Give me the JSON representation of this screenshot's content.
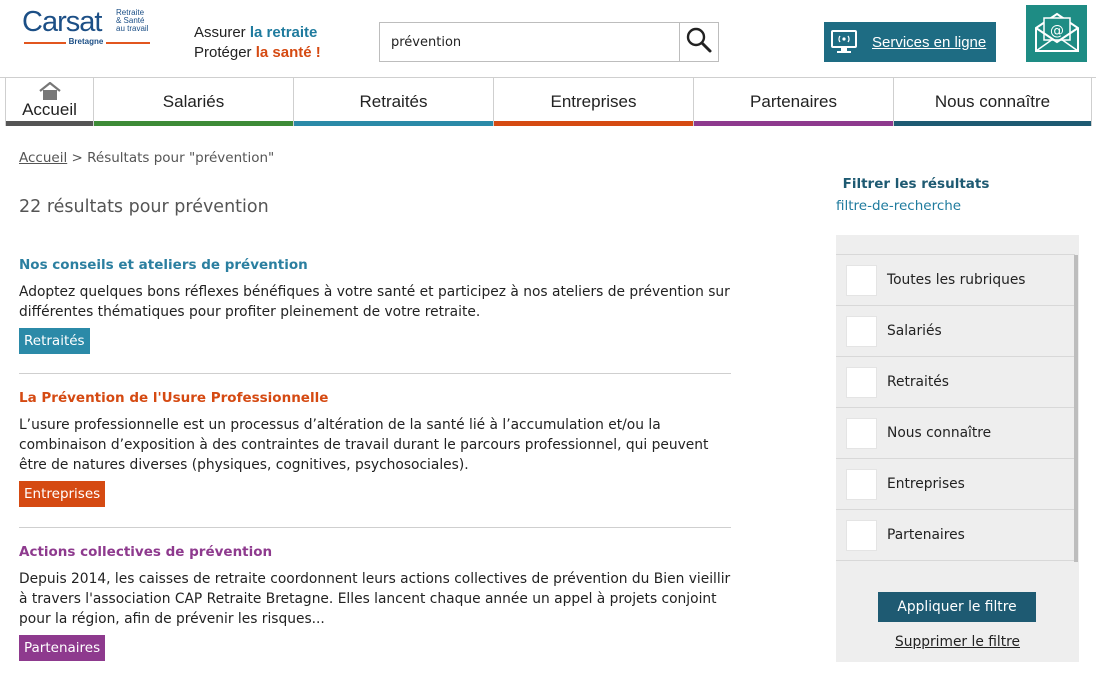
{
  "header": {
    "logo": {
      "name": "Carsat",
      "tagline_lines": [
        "Retraite",
        "& Santé",
        "au travail"
      ],
      "region": "Bretagne"
    },
    "tagline": {
      "line1_prefix": "Assurer ",
      "line1_highlight": "la retraite",
      "line2_prefix": "Protéger ",
      "line2_highlight": "la santé !"
    },
    "search": {
      "value": "prévention",
      "icon": "search-icon"
    },
    "services_label": "Services en ligne",
    "services_icon": "monitor-signal-icon",
    "mail_icon": "email-icon"
  },
  "nav": {
    "items": [
      {
        "label": "Accueil",
        "color": "#555555",
        "icon": "home-icon"
      },
      {
        "label": "Salariés",
        "color": "#3d8b37"
      },
      {
        "label": "Retraités",
        "color": "#2b8aa8"
      },
      {
        "label": "Entreprises",
        "color": "#d54a12"
      },
      {
        "label": "Partenaires",
        "color": "#8e3a8e"
      },
      {
        "label": "Nous connaître",
        "color": "#1e5a72"
      }
    ]
  },
  "breadcrumb": {
    "home": "Accueil",
    "separator": ">",
    "current": "Résultats pour \"prévention\""
  },
  "results": {
    "count_text": "22 résultats pour prévention",
    "items": [
      {
        "title": "Nos conseils et ateliers de prévention",
        "title_color": "#2b7fa0",
        "description": "Adoptez quelques bons réflexes bénéfiques à votre santé et participez à nos ateliers de prévention sur différentes thématiques pour profiter pleinement de votre retraite.",
        "tag": "Retraités",
        "tag_color": "#2b8aa8"
      },
      {
        "title": "La Prévention de l'Usure Professionnelle",
        "title_color": "#d54a12",
        "description": "L’usure professionnelle est un processus d’altération de la santé lié à l’accumulation et/ou la combinaison d’exposition à des contraintes de travail durant le parcours professionnel, qui peuvent être de natures diverses (physiques, cognitives, psychosociales).",
        "tag": "Entreprises",
        "tag_color": "#d54a12"
      },
      {
        "title": "Actions collectives de prévention",
        "title_color": "#8e3a8e",
        "description": "Depuis 2014, les caisses de retraite coordonnent leurs actions collectives de prévention du Bien vieillir à travers l'association CAP Retraite Bretagne. Elles lancent chaque année un appel à projets conjoint pour la région, afin de prévenir les risques...",
        "tag": "Partenaires",
        "tag_color": "#8e3a8e"
      }
    ]
  },
  "filter": {
    "heading": "Filtrer les résultats",
    "subheading": "filtre-de-recherche",
    "options": [
      "Toutes les rubriques",
      "Salariés",
      "Retraités",
      "Nous connaître",
      "Entreprises",
      "Partenaires"
    ],
    "apply_label": "Appliquer le filtre",
    "remove_label": "Supprimer le filtre"
  }
}
